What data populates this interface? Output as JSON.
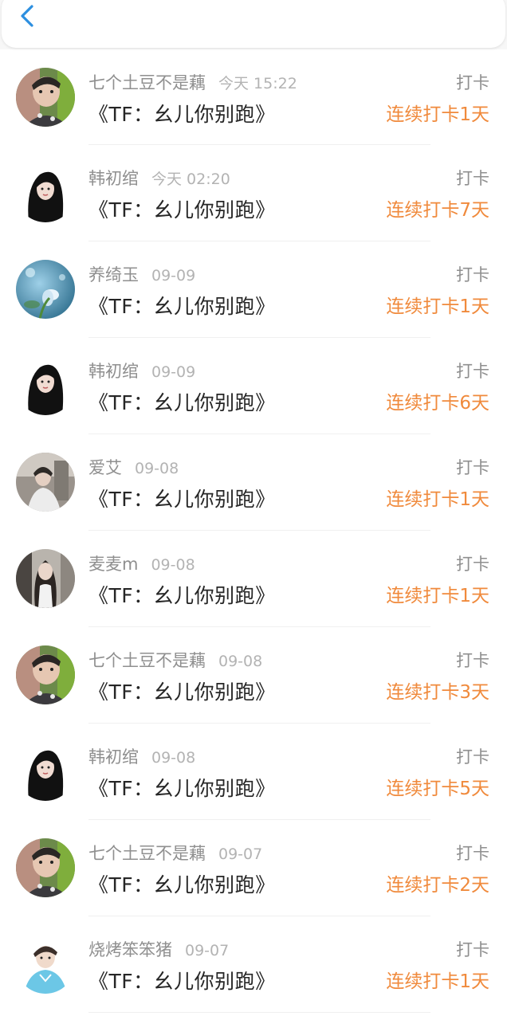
{
  "header": {
    "back_icon": "chevron-left-icon",
    "accent_color": "#2d8fe0"
  },
  "colors": {
    "streak": "#f08a3c",
    "username": "#8f8f8f",
    "time": "#b3b3b3",
    "title": "#262626"
  },
  "items": [
    {
      "username": "七个土豆不是藕",
      "time": "今天 15:22",
      "title": "《TF：幺儿你别跑》",
      "action": "打卡",
      "streak": "连续打卡1天",
      "avatar": "avatar-boy-green"
    },
    {
      "username": "韩初绾",
      "time": "今天 02:20",
      "title": "《TF：幺儿你别跑》",
      "action": "打卡",
      "streak": "连续打卡7天",
      "avatar": "avatar-girl-black-hair"
    },
    {
      "username": "养绮玉",
      "time": "09-09",
      "title": "《TF：幺儿你别跑》",
      "action": "打卡",
      "streak": "连续打卡1天",
      "avatar": "avatar-blue-flower"
    },
    {
      "username": "韩初绾",
      "time": "09-09",
      "title": "《TF：幺儿你别跑》",
      "action": "打卡",
      "streak": "连续打卡6天",
      "avatar": "avatar-girl-black-hair"
    },
    {
      "username": "爱艾",
      "time": "09-08",
      "title": "《TF：幺儿你别跑》",
      "action": "打卡",
      "streak": "连续打卡1天",
      "avatar": "avatar-grey-photo"
    },
    {
      "username": "麦麦m",
      "time": "09-08",
      "title": "《TF：幺儿你别跑》",
      "action": "打卡",
      "streak": "连续打卡1天",
      "avatar": "avatar-girl-long-hair"
    },
    {
      "username": "七个土豆不是藕",
      "time": "09-08",
      "title": "《TF：幺儿你别跑》",
      "action": "打卡",
      "streak": "连续打卡3天",
      "avatar": "avatar-boy-green"
    },
    {
      "username": "韩初绾",
      "time": "09-08",
      "title": "《TF：幺儿你别跑》",
      "action": "打卡",
      "streak": "连续打卡5天",
      "avatar": "avatar-girl-black-hair"
    },
    {
      "username": "七个土豆不是藕",
      "time": "09-07",
      "title": "《TF：幺儿你别跑》",
      "action": "打卡",
      "streak": "连续打卡2天",
      "avatar": "avatar-boy-green"
    },
    {
      "username": "烧烤笨笨猪",
      "time": "09-07",
      "title": "《TF：幺儿你别跑》",
      "action": "打卡",
      "streak": "连续打卡1天",
      "avatar": "avatar-boy-blue-shirt"
    }
  ]
}
